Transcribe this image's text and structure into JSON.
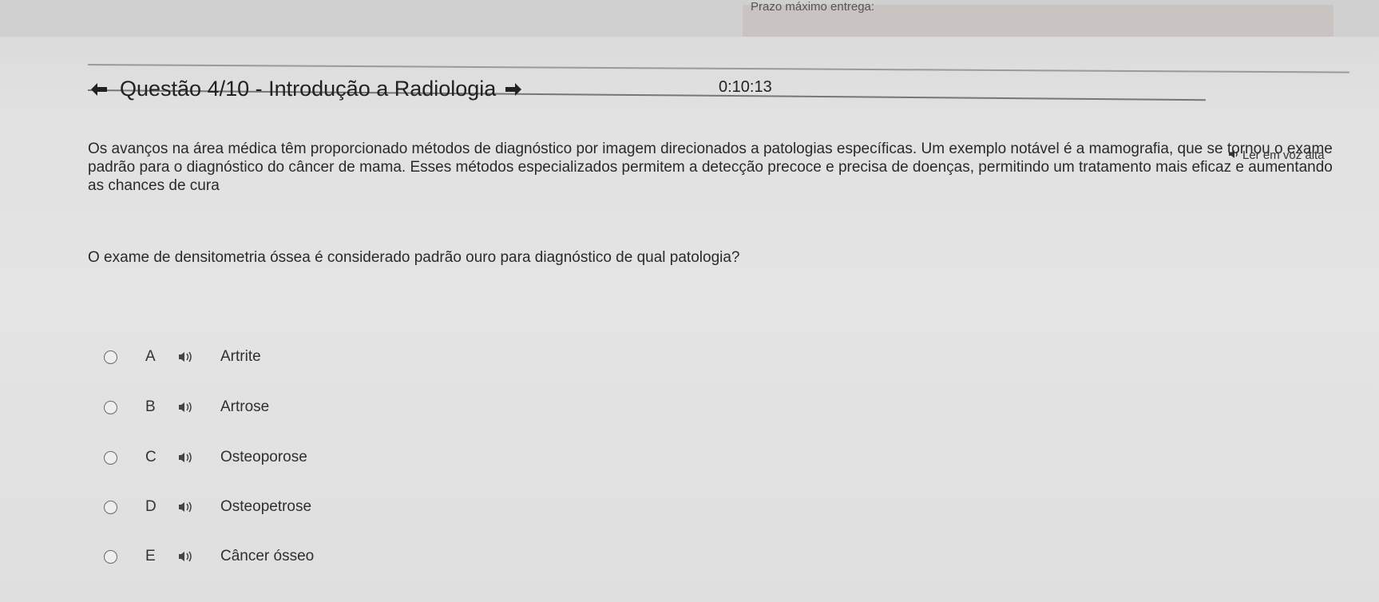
{
  "header": {
    "deadline_label": "Prazo máximo entrega:"
  },
  "timer": "0:10:13",
  "title": "Questão 4/10 - Introdução a Radiologia",
  "read_aloud_label": "Ler em voz alta",
  "body_text": "Os avanços na área médica têm proporcionado métodos de diagnóstico por imagem direcionados a patologias específicas. Um exemplo notável é a mamografia, que se tornou o exame padrão para o diagnóstico do câncer de mama. Esses métodos especializados permitem a detecção precoce e precisa de doenças, permitindo um tratamento mais eficaz e aumentando as chances de cura",
  "question": "O exame de densitometria óssea é considerado padrão ouro para diagnóstico de qual patologia?",
  "options": [
    {
      "letter": "A",
      "text": "Artrite"
    },
    {
      "letter": "B",
      "text": "Artrose"
    },
    {
      "letter": "C",
      "text": "Osteoporose"
    },
    {
      "letter": "D",
      "text": "Osteopetrose"
    },
    {
      "letter": "E",
      "text": "Câncer ósseo"
    }
  ],
  "icons": {
    "prev": "arrow-left-icon",
    "next": "arrow-right-icon",
    "speaker": "speaker-icon"
  }
}
